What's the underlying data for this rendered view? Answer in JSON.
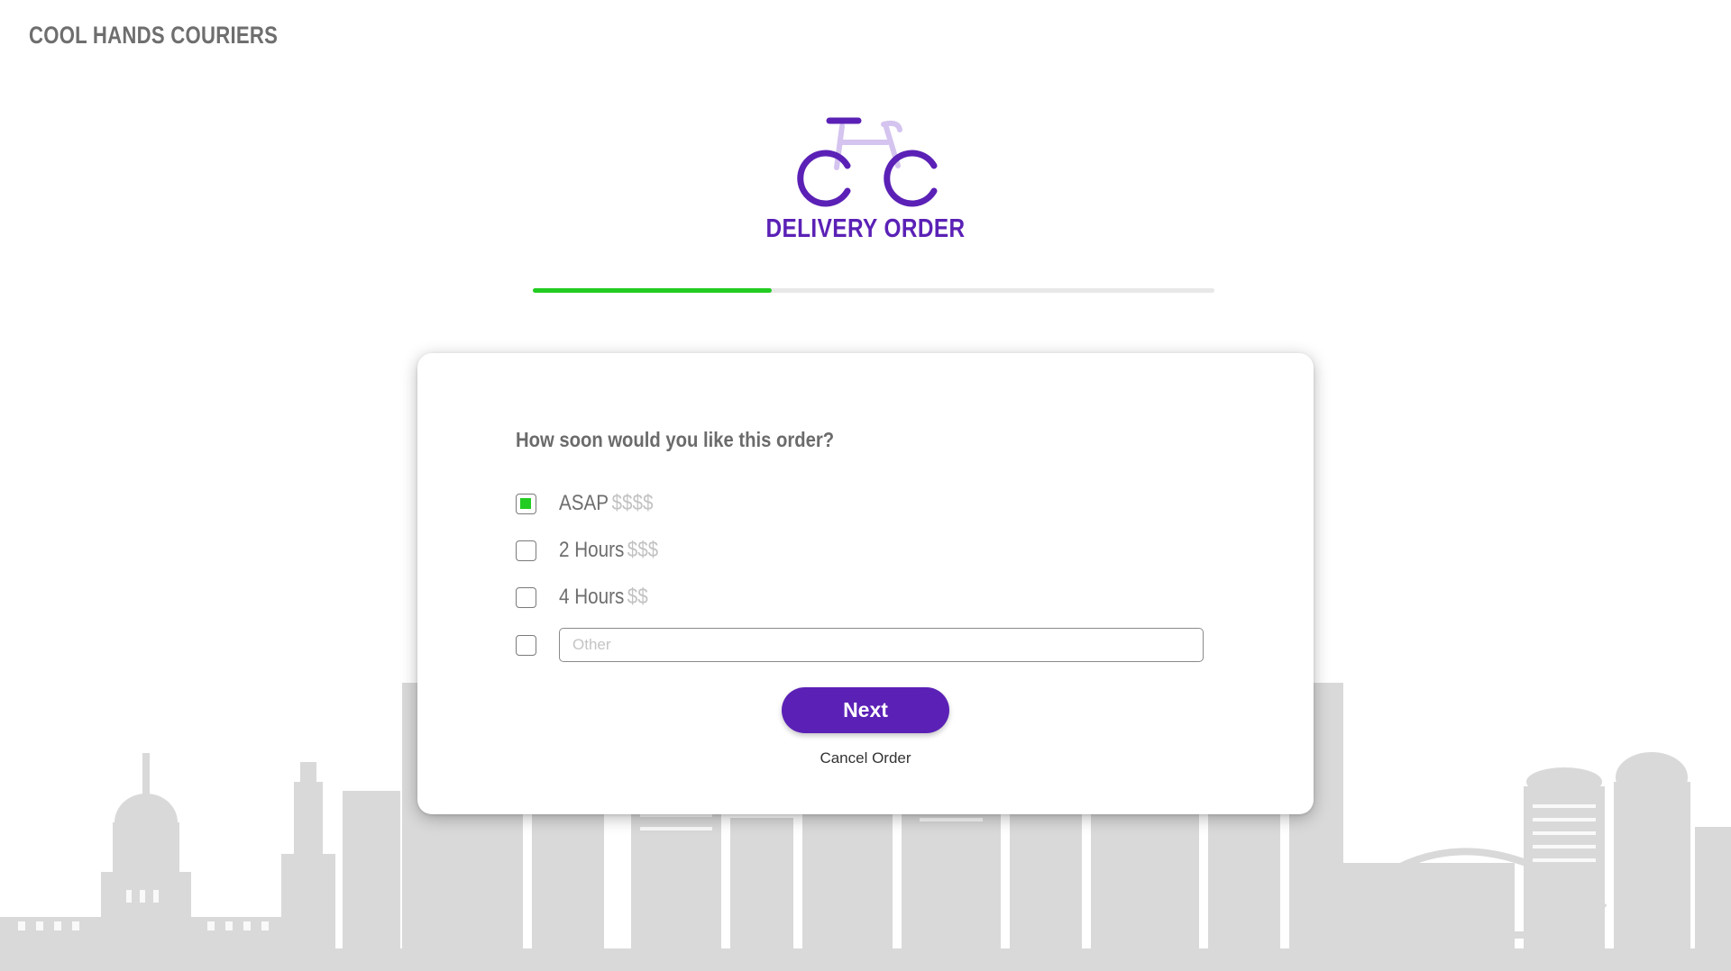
{
  "header": {
    "brand": "COOL HANDS COURIERS"
  },
  "logo": {
    "title": "DELIVERY ORDER",
    "icon": "bicycle-icon"
  },
  "progress": {
    "fraction": 0.35
  },
  "form": {
    "question": "How soon would you like this order?",
    "options": [
      {
        "label": "ASAP",
        "price": "$$$$",
        "checked": true
      },
      {
        "label": "2 Hours",
        "price": "$$$",
        "checked": false
      },
      {
        "label": "4 Hours",
        "price": "$$",
        "checked": false
      },
      {
        "label": "",
        "price": "",
        "checked": false
      }
    ],
    "other_placeholder": "Other",
    "other_value": "",
    "next_label": "Next",
    "cancel_label": "Cancel Order"
  },
  "colors": {
    "brand_purple": "#5b21b6",
    "light_purple": "#d4c4ef",
    "progress_green": "#22cc22",
    "skyline_gray": "#d9d9d9"
  }
}
